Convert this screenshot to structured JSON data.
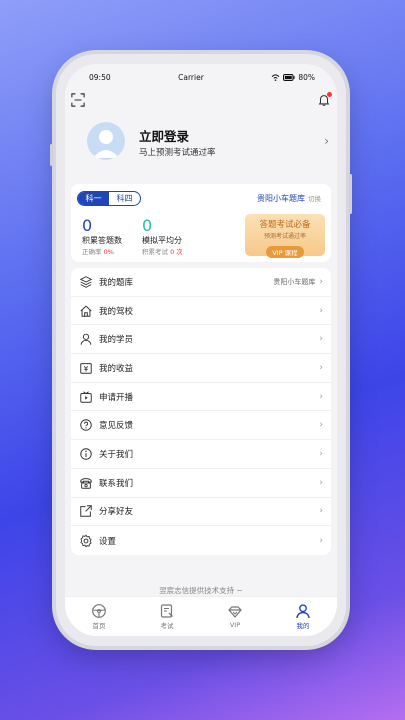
{
  "status": {
    "time": "09:50",
    "carrier": "Carrier",
    "battery": "80%"
  },
  "login": {
    "title": "立即登录",
    "subtitle": "马上预测考试通过率"
  },
  "subjects": {
    "active": "科一",
    "inactive": "科四"
  },
  "bank": {
    "name": "贵阳小车题库",
    "switch": "切换"
  },
  "stats": {
    "answered_value": "0",
    "answered_label": "积累答题数",
    "accuracy_label": "正确率",
    "accuracy_value": "0%",
    "avg_value": "0",
    "avg_label": "模拟平均分",
    "exam_label": "积累考试",
    "exam_value": "0 次"
  },
  "vip": {
    "title": "答题考试必备",
    "subtitle": "预测考试通过率",
    "badge": "VIP 课程"
  },
  "menu": [
    {
      "label": "我的题库",
      "extra": "贵阳小车题库"
    },
    {
      "label": "我的驾校",
      "extra": ""
    },
    {
      "label": "我的学员",
      "extra": ""
    },
    {
      "label": "我的收益",
      "extra": ""
    },
    {
      "label": "申请开播",
      "extra": ""
    },
    {
      "label": "意见反馈",
      "extra": ""
    },
    {
      "label": "关于我们",
      "extra": ""
    },
    {
      "label": "联系我们",
      "extra": ""
    },
    {
      "label": "分享好友",
      "extra": ""
    },
    {
      "label": "设置",
      "extra": ""
    }
  ],
  "footer": "翌宸志信提供技术支持 ~",
  "tabs": [
    {
      "label": "首页"
    },
    {
      "label": "考试"
    },
    {
      "label": "VIP"
    },
    {
      "label": "我的"
    }
  ],
  "colors": {
    "primary": "#1f45b6",
    "accent": "#22c3a5",
    "vip": "#e89a3a"
  }
}
